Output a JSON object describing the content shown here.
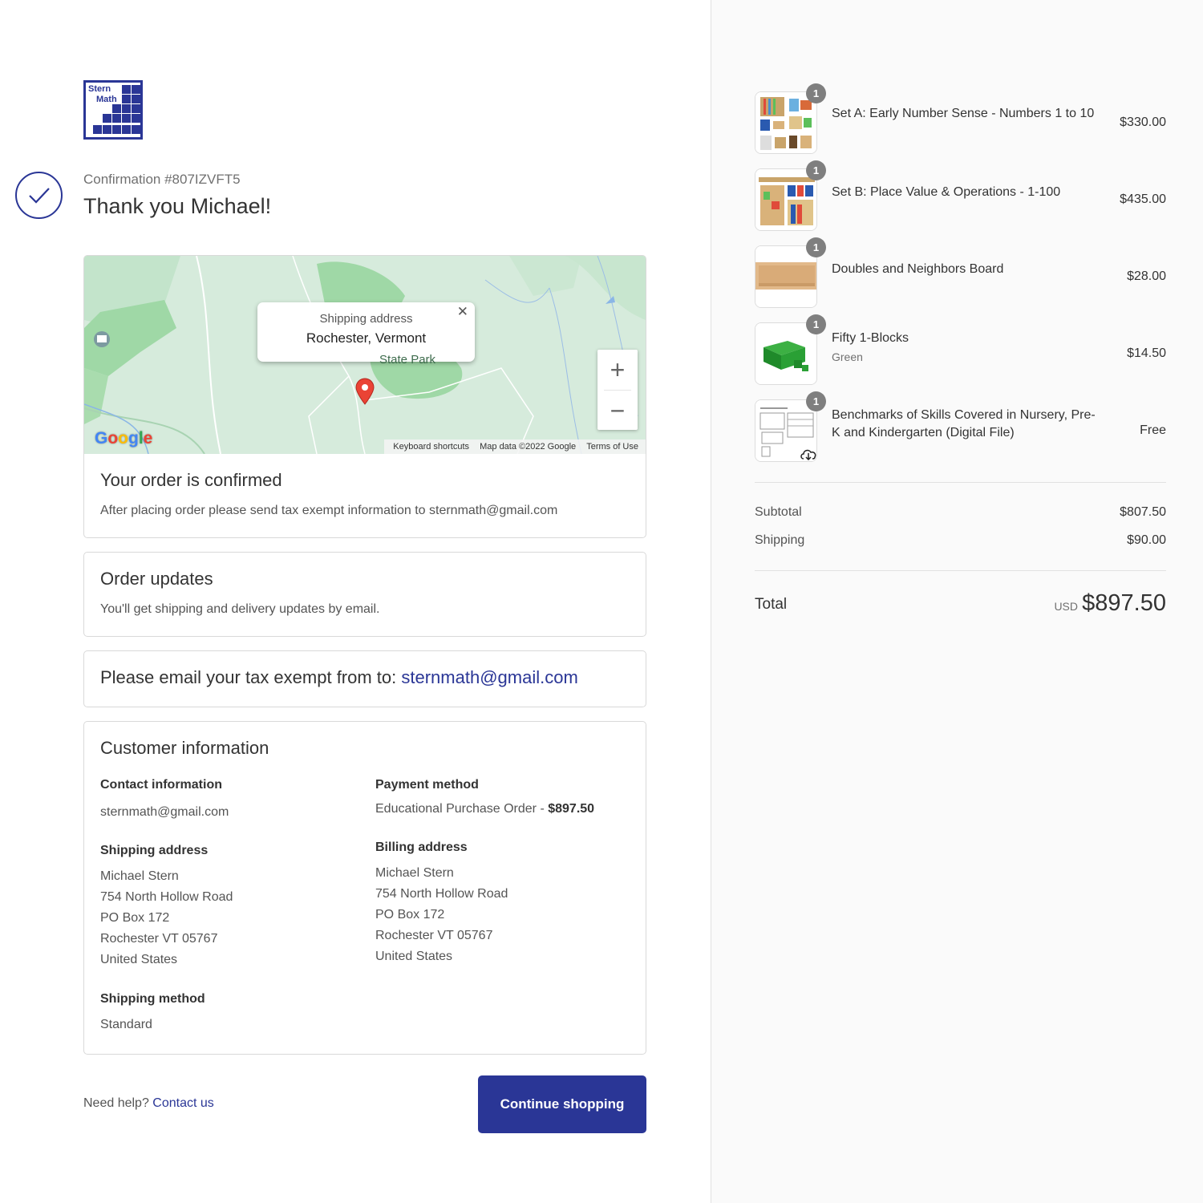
{
  "brand": {
    "logo_line1": "Stern",
    "logo_line2": "Math",
    "accent": "#2a3696"
  },
  "confirmation": {
    "number_label": "Confirmation #807IZVFT5",
    "thank_you": "Thank you Michael!"
  },
  "map": {
    "popup_title": "Shipping address",
    "popup_city": "Rochester, Vermont",
    "park_label": "State Park",
    "zoom_in": "+",
    "zoom_out": "−",
    "attr_shortcuts": "Keyboard shortcuts",
    "attr_data": "Map data ©2022 Google",
    "attr_terms": "Terms of Use",
    "google_logo": "Google"
  },
  "order_confirmed": {
    "title": "Your order is confirmed",
    "text": "After placing order please send tax exempt information to sternmath@gmail.com"
  },
  "order_updates": {
    "title": "Order updates",
    "text": "You'll get shipping and delivery updates by email."
  },
  "tax_note": {
    "text": "Please email your tax exempt from to: ",
    "email": "sternmath@gmail.com"
  },
  "customer": {
    "title": "Customer information",
    "contact_label": "Contact information",
    "contact_email": "sternmath@gmail.com",
    "payment_label": "Payment method",
    "payment_method": "Educational Purchase Order - ",
    "payment_amount": "$897.50",
    "shipping_label": "Shipping address",
    "shipping_lines": [
      "Michael Stern",
      "754 North Hollow Road",
      "PO Box 172",
      "Rochester VT 05767",
      "United States"
    ],
    "billing_label": "Billing address",
    "billing_lines": [
      "Michael Stern",
      "754 North Hollow Road",
      "PO Box 172",
      "Rochester VT 05767",
      "United States"
    ],
    "method_label": "Shipping method",
    "method_value": "Standard"
  },
  "footer": {
    "help_text": "Need help? ",
    "contact_link": "Contact us",
    "continue_button": "Continue shopping"
  },
  "items": [
    {
      "name": "Set A: Early Number Sense - Numbers 1 to 10",
      "variant": "",
      "qty": "1",
      "price": "$330.00",
      "thumb": "set-a-thumbnail"
    },
    {
      "name": "Set B: Place Value & Operations - 1-100",
      "variant": "",
      "qty": "1",
      "price": "$435.00",
      "thumb": "set-b-thumbnail"
    },
    {
      "name": "Doubles and Neighbors Board",
      "variant": "",
      "qty": "1",
      "price": "$28.00",
      "thumb": "board-thumbnail"
    },
    {
      "name": "Fifty 1-Blocks",
      "variant": "Green",
      "qty": "1",
      "price": "$14.50",
      "thumb": "blocks-thumbnail"
    },
    {
      "name": "Benchmarks of Skills Covered in Nursery, Pre-K and Kindergarten (Digital File)",
      "variant": "",
      "qty": "1",
      "price": "Free",
      "thumb": "document-thumbnail"
    }
  ],
  "summary": {
    "subtotal_label": "Subtotal",
    "subtotal": "$807.50",
    "shipping_label": "Shipping",
    "shipping": "$90.00",
    "total_label": "Total",
    "currency": "USD",
    "total": "$897.50"
  }
}
